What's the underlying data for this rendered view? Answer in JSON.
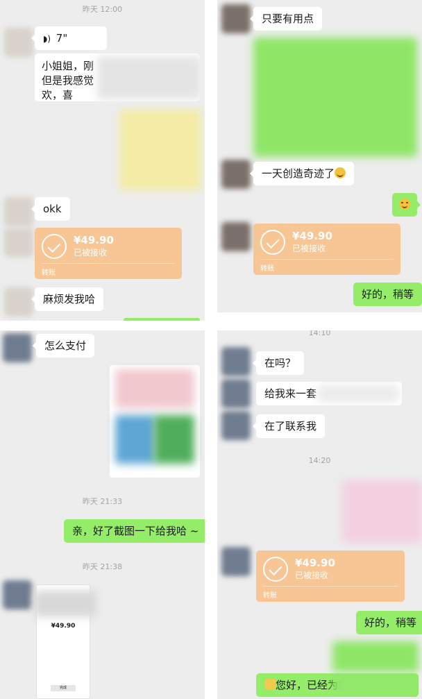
{
  "panel1": {
    "timestamp": "昨天 12:00",
    "voice_duration": "7\"",
    "message_partial_line1": "小姐姐，刚",
    "message_partial_line2": "但是我感觉",
    "message_partial_line3": "欢，喜",
    "okk": "okk",
    "transfer": {
      "amount": "¥49.90",
      "status": "已被接收",
      "type": "转账"
    },
    "request": "麻烦发我哈"
  },
  "panel2": {
    "msg_useful": "只要有用点",
    "msg_miracle": "一天创造奇迹了",
    "transfer": {
      "amount": "¥49.90",
      "status": "已被接收",
      "type": "转账"
    },
    "reply_ok": "好的，稍等"
  },
  "panel3": {
    "msg_pay": "怎么支付",
    "timestamp1": "昨天 21:33",
    "msg_screenshot": "亲，好了截图一下给我哈 ~",
    "timestamp2": "昨天 21:38",
    "phone_amount": "¥49.90",
    "phone_button": "完成"
  },
  "panel4": {
    "timestamp_top": "14:10",
    "msg_here": "在吗？",
    "msg_give": "给我来一套",
    "msg_contact": "在了联系我",
    "timestamp_mid": "14:20",
    "transfer": {
      "amount": "¥49.90",
      "status": "已被接收",
      "type": "转账"
    },
    "reply_ok": "好的，稍等",
    "msg_greeting": "您好，已经为您"
  },
  "colors": {
    "chat_bg": "#ededed",
    "green_bubble": "#95ec69",
    "transfer_orange": "#f8c694"
  },
  "icons": [
    "voice-icon",
    "check-circle-icon",
    "sweat-emoji-icon",
    "smile-emoji-icon",
    "heart-emoji-icon"
  ]
}
